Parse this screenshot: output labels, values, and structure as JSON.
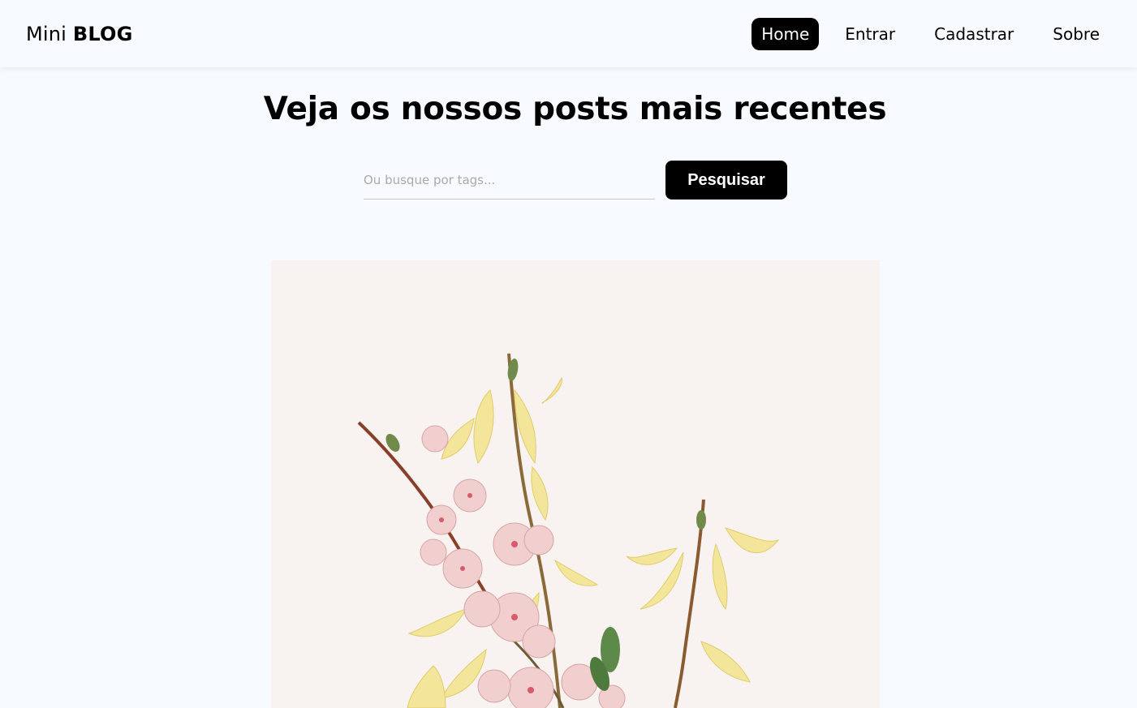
{
  "navbar": {
    "brand_regular": "Mini",
    "brand_bold": "BLOG",
    "links": [
      {
        "label": "Home",
        "active": true
      },
      {
        "label": "Entrar",
        "active": false
      },
      {
        "label": "Cadastrar",
        "active": false
      },
      {
        "label": "Sobre",
        "active": false
      }
    ]
  },
  "main": {
    "title": "Veja os nossos posts mais recentes",
    "search": {
      "placeholder": "Ou busque por tags...",
      "value": "",
      "button_label": "Pesquisar"
    }
  },
  "post": {
    "image_subject": "botanical-illustration-flowering-branches"
  },
  "colors": {
    "background": "#f7fbff",
    "accent": "#000000",
    "image_background": "#f8f3f0"
  }
}
